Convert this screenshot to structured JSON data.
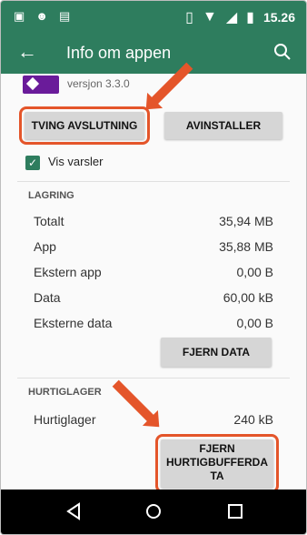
{
  "statusbar": {
    "time": "15.26",
    "icons_left": [
      "image-icon",
      "android-icon",
      "app-icon"
    ],
    "icons_right": [
      "vibrate-icon",
      "wifi-icon",
      "signal-icon",
      "battery-icon"
    ]
  },
  "appbar": {
    "title": "Info om appen"
  },
  "app": {
    "version": "versjon 3.3.0"
  },
  "actions": {
    "force_stop": "TVING AVSLUTNING",
    "uninstall": "AVINSTALLER"
  },
  "notifications": {
    "label": "Vis varsler",
    "checked": true
  },
  "storage": {
    "header": "LAGRING",
    "rows": [
      {
        "label": "Totalt",
        "value": "35,94 MB"
      },
      {
        "label": "App",
        "value": "35,88 MB"
      },
      {
        "label": "Ekstern app",
        "value": "0,00 B"
      },
      {
        "label": "Data",
        "value": "60,00 kB"
      },
      {
        "label": "Eksterne data",
        "value": "0,00 B"
      }
    ],
    "clear_data": "FJERN DATA"
  },
  "cache": {
    "header": "HURTIGLAGER",
    "label": "Hurtiglager",
    "value": "240 kB",
    "clear_cache_line1": "FJERN",
    "clear_cache_line2": "HURTIGBUFFERDA",
    "clear_cache_line3": "TA"
  },
  "colors": {
    "primary": "#2e7d5e",
    "highlight": "#e4552a"
  }
}
